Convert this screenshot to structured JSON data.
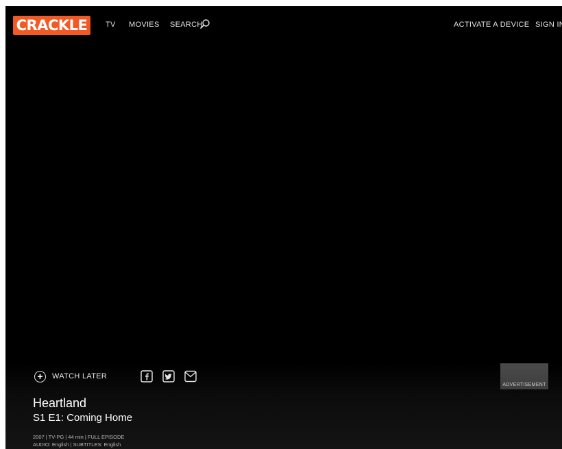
{
  "header": {
    "logo": "CRACKLE",
    "nav": {
      "tv": "TV",
      "movies": "MOVIES",
      "search": "SEARCH",
      "activate": "ACTIVATE A DEVICE",
      "sign_in": "SIGN IN"
    }
  },
  "actions": {
    "watch_later": "WATCH LATER",
    "share_icons": [
      "facebook-icon",
      "twitter-icon",
      "mail-icon"
    ]
  },
  "ad": {
    "label": "ADVERTISEMENT"
  },
  "episode": {
    "show_title": "Heartland",
    "episode_title": "S1 E1: Coming Home",
    "meta": "2007 | TV-PG | 44 min | FULL EPISODE",
    "audio_subtitles": "AUDIO: English | SUBTITLES: English"
  },
  "colors": {
    "brand": "#f15a24",
    "background": "#000000",
    "text": "#ffffff"
  }
}
